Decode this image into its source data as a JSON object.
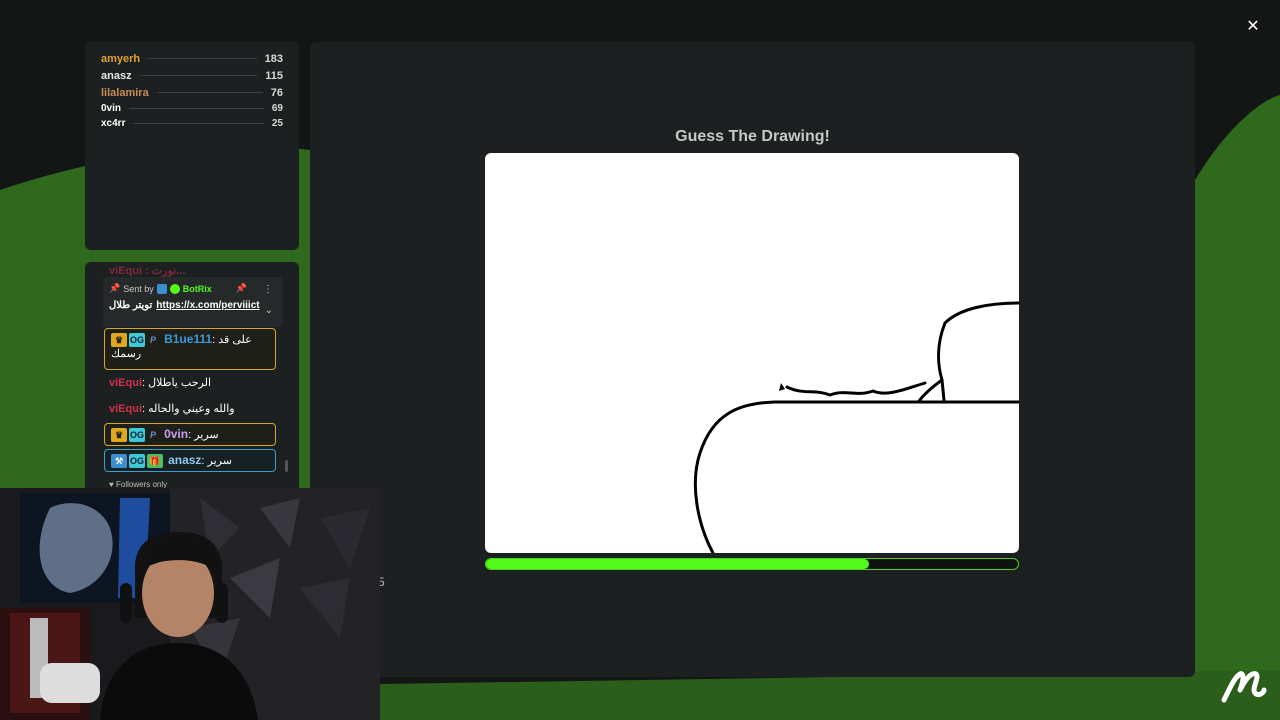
{
  "game": {
    "title": "Guess The Drawing!",
    "timer_remaining_fraction": 0.72,
    "stray_char": "5"
  },
  "leaderboard": [
    {
      "name": "amyerh",
      "score": "183",
      "color": "#e0a030"
    },
    {
      "name": "anasz",
      "score": "115",
      "color": "#e6e6e6"
    },
    {
      "name": "lilalamira",
      "score": "76",
      "color": "#c88a50"
    },
    {
      "name": "0vin",
      "score": "69",
      "color": "#ffffff"
    },
    {
      "name": "xc4rr",
      "score": "25",
      "color": "#ffffff"
    }
  ],
  "chat": {
    "cut_top": "viEqui : نورت...",
    "pinned": {
      "sent_by": "Sent by",
      "bot_name": "BotRix",
      "message_prefix": "تويتر طلال",
      "link": "https://x.com/perviiict"
    },
    "messages": [
      {
        "user": "B1ue111",
        "text": "على قد رسمك",
        "user_color": "#3a9ad8"
      },
      {
        "user": "viEqui",
        "text": "الرحب ياطلال"
      },
      {
        "user": "viEqui",
        "text": "والله وعيني والحاله"
      },
      {
        "user": "0vin",
        "text": "سرير",
        "user_color": "#c8a0f0"
      },
      {
        "user": "anasz",
        "text": "سرير",
        "user_color": "#90c8f0"
      }
    ],
    "mode": "Followers only"
  },
  "colors": {
    "accent_green": "#53fc18",
    "panel": "#1d2020",
    "background": "#141616"
  },
  "icons": [
    "close-icon",
    "brand-logo-icon",
    "pin-icon",
    "more-icon",
    "chevron-down-icon",
    "heart-icon"
  ]
}
